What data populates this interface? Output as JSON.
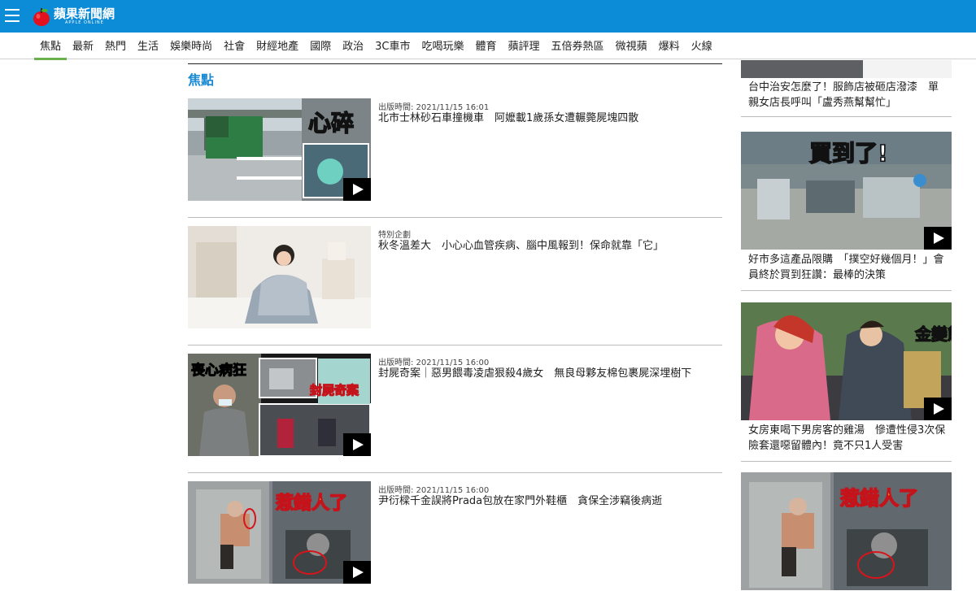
{
  "header": {
    "logo_text": "蘋果新聞網",
    "logo_sub": "APPLE ONLINE",
    "brand_color": "#0c8bd6"
  },
  "nav": {
    "items": [
      "焦點",
      "最新",
      "熱門",
      "生活",
      "娛樂時尚",
      "社會",
      "財經地產",
      "國際",
      "政治",
      "3C車市",
      "吃喝玩樂",
      "體育",
      "蘋評理",
      "五倍券熱區",
      "微視蘋",
      "爆料",
      "火線"
    ],
    "active_index": 0,
    "active_color": "#6ab04c"
  },
  "main": {
    "section_title": "焦點",
    "articles": [
      {
        "meta": "出版時間: 2021/11/15 16:01",
        "headline": "北市士林砂石車撞機車　阿嬤載1歲孫女遭輾斃屍塊四散",
        "thumb_caption": "心碎",
        "video": true
      },
      {
        "meta": "特別企劃",
        "headline": "秋冬溫差大　小心心血管疾病、腦中風報到！保命就靠「它」",
        "thumb_caption": "",
        "video": false
      },
      {
        "meta": "出版時間: 2021/11/15 16:00",
        "headline": "封屍奇案｜惡男餵毒凌虐狠殺4歲女　無良母夥友棉包裹屍深埋樹下",
        "thumb_caption": "喪心病狂",
        "thumb_caption_2": "封屍奇案",
        "video": true
      },
      {
        "meta": "出版時間: 2021/11/15 16:00",
        "headline": "尹衍樑千金誤將Prada包放在家門外鞋櫃　貪保全涉竊後病逝",
        "thumb_caption": "惹錯人了",
        "video": true
      }
    ]
  },
  "sidebar": {
    "items": [
      {
        "caption": "台中治安怎麼了！服飾店被砸店潑漆　單親女店長呼叫「盧秀燕幫幫忙」",
        "thumb_caption": "",
        "video": false
      },
      {
        "caption": "好市多這產品限購　「撲空好幾個月！」會員終於買到狂讚：最棒的決策",
        "thumb_caption": "買到了!",
        "video": true
      },
      {
        "caption": "女房東喝下男房客的雞湯　慘遭性侵3次保險套還噁留體內！竟不只1人受害",
        "thumb_caption": "金變態!",
        "video": true
      },
      {
        "caption": "",
        "thumb_caption": "惹錯人了",
        "video": false
      }
    ]
  }
}
